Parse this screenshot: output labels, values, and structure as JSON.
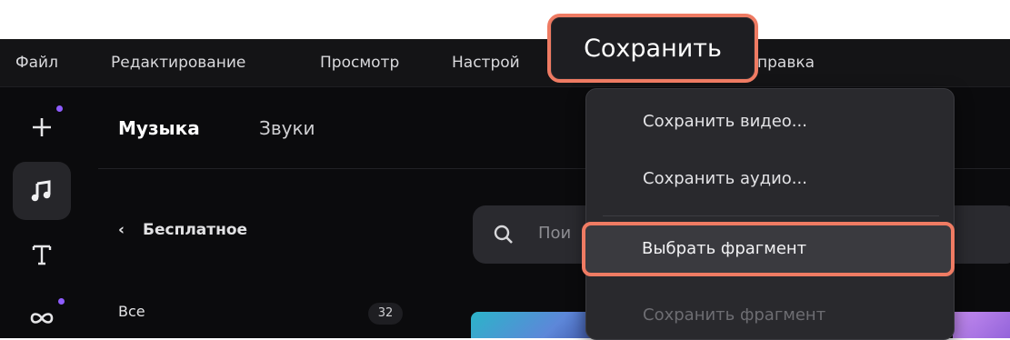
{
  "menubar": {
    "items": [
      "Файл",
      "Редактирование",
      "Просмотр",
      "Настройки",
      "Справка"
    ],
    "visible_parts": [
      "Файл",
      "Редактирование",
      "Просмотр",
      "Настрой",
      "правка"
    ]
  },
  "highlight": {
    "save_label": "Сохранить",
    "color": "#ef7b63"
  },
  "dropdown": {
    "items": [
      {
        "label": "Сохранить видео...",
        "enabled": true
      },
      {
        "label": "Сохранить аудио...",
        "enabled": true
      },
      {
        "label": "Выбрать фрагмент",
        "enabled": true,
        "highlighted": true
      },
      {
        "label": "Сохранить фрагмент",
        "enabled": false
      }
    ]
  },
  "tabs": [
    {
      "label": "Музыка",
      "active": true
    },
    {
      "label": "Звуки",
      "active": false
    }
  ],
  "sidebar": {
    "icons": [
      "add-icon",
      "music-note-icon",
      "text-icon",
      "transitions-icon"
    ],
    "accent": "#8e5cff"
  },
  "categories": {
    "back_label": "Бесплатное",
    "items": [
      {
        "label": "Все",
        "count": "32"
      }
    ]
  },
  "search": {
    "placeholder_visible": "Пои"
  }
}
